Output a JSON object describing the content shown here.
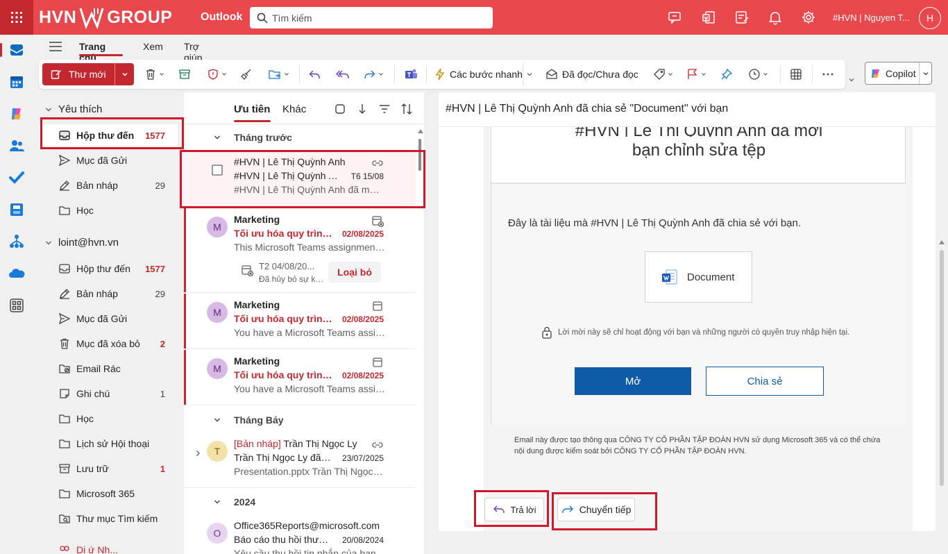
{
  "topbar": {
    "brand_left": "HVN",
    "brand_right": "GROUP",
    "app": "Outlook",
    "search_placeholder": "Tìm kiếm",
    "user": "#HVN | Nguyen T...",
    "avatar": "H"
  },
  "ribbon": {
    "tabs": [
      "Trang chủ",
      "Xem",
      "Trợ giúp"
    ],
    "new_mail": "Thư mới",
    "quick_steps": "Các bước nhanh",
    "read_unread": "Đã đọc/Chưa đọc",
    "copilot": "Copilot"
  },
  "folders": {
    "favorites_head": "Yêu thích",
    "favorites": [
      {
        "label": "Hộp thư đến",
        "count": "1577"
      },
      {
        "label": "Mục đã Gửi",
        "count": ""
      },
      {
        "label": "Bản nháp",
        "count": "29"
      },
      {
        "label": "Học",
        "count": ""
      }
    ],
    "account_head": "loint@hvn.vn",
    "account": [
      {
        "label": "Hộp thư đến",
        "count": "1577"
      },
      {
        "label": "Bản nháp",
        "count": "29"
      },
      {
        "label": "Mục đã Gửi",
        "count": ""
      },
      {
        "label": "Mục đã xóa bỏ",
        "count": "2"
      },
      {
        "label": "Email Rác",
        "count": ""
      },
      {
        "label": "Ghi chú",
        "count": "1"
      },
      {
        "label": "Học",
        "count": ""
      },
      {
        "label": "Lịch sử Hội thoại",
        "count": ""
      },
      {
        "label": "Lưu trữ",
        "count": "1"
      },
      {
        "label": "Microsoft 365",
        "count": ""
      },
      {
        "label": "Thư mục Tìm kiếm",
        "count": ""
      },
      {
        "label": "Dị ứ Nh...",
        "count": ""
      }
    ]
  },
  "list": {
    "tab_focused": "Ưu tiên",
    "tab_other": "Khác",
    "groups": [
      "Tháng trước",
      "Tháng Bảy",
      "2024"
    ],
    "messages": [
      {
        "from": "#HVN | Lê Thị Quỳnh Anh",
        "subject": "#HVN | Lê Thị Quỳnh Anh đã chia sẻ \"Document\"...",
        "date": "T6 15/08",
        "preview": "#HVN | Lê Thị Quỳnh Anh đã mời bạn chỉnh sửa tệp"
      },
      {
        "avatar": "M",
        "from": "Marketing",
        "subject": "Tối ưu hóa quy trình làm việc",
        "date": "02/08/2025",
        "preview": "This Microsoft Teams assignment has been cancelled",
        "meeting_time": "T2 04/08/20...",
        "meeting_status": "Đã hủy bỏ sự kiện",
        "dismiss": "Loại bỏ"
      },
      {
        "avatar": "M",
        "from": "Marketing",
        "subject": "Tối ưu hóa quy trình làm việc",
        "date": "02/08/2025",
        "preview": "You have a Microsoft Teams assignment"
      },
      {
        "avatar": "M",
        "from": "Marketing",
        "subject": "Tối ưu hóa quy trình làm việc",
        "date": "02/08/2025",
        "preview": "You have a Microsoft Teams assignment"
      },
      {
        "avatar": "T",
        "draft_tag": "[Bản nháp]",
        "from": "Trần Thị Ngọc Ly",
        "subject": "Trần Thị Ngọc Ly đã chia sẻ",
        "date": "23/07/2025",
        "preview": "Presentation.pptx Trần Thị Ngọc Ly"
      },
      {
        "avatar": "O",
        "from": "Office365Reports@microsoft.com",
        "subject": "Báo cáo thu hồi thư cho",
        "date": "20/08/2024",
        "preview": "Yêu cầu thu hồi tin nhắn của bạn"
      }
    ]
  },
  "reading": {
    "subject": "#HVN | Lê Thị Quỳnh Anh đã chia sẻ \"Document\" với bạn",
    "card_title_top": "#HVN | Lê Thị Quỳnh Anh đã mời",
    "card_title": "bạn chỉnh sửa tệp",
    "description": "Đây là tài liệu mà #HVN | Lê Thị Quỳnh Anh đã chia sẻ với bạn.",
    "doc_name": "Document",
    "notice": "Lời mời này sẽ chỉ hoạt động với bạn và những người có quyền truy nhập hiện tại.",
    "open": "Mở",
    "share": "Chia sẻ",
    "footer": "Email này được tạo thông qua CÔNG TY CỔ PHẦN TẬP ĐOÀN HVN sử dụng Microsoft 365 và có thể chứa nội dung được kiểm soát bởi CÔNG TY CỔ PHẦN TẬP ĐOÀN HVN.",
    "reply": "Trả lời",
    "forward": "Chuyển tiếp"
  },
  "colors": {
    "brand": "#e8474c",
    "accent": "#c3282e",
    "button_blue": "#0f5ba7",
    "highlight_box": "#d0172b"
  }
}
